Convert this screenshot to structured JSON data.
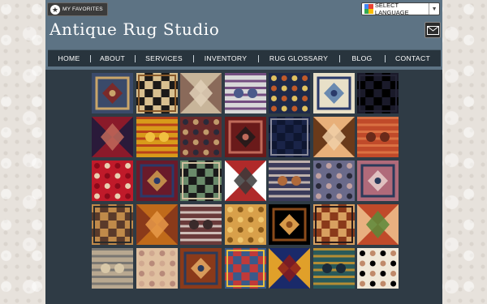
{
  "header": {
    "favorites_label": "MY FAVORITES",
    "language_label": "SELECT LANGUAGE",
    "site_title": "Antique Rug Studio"
  },
  "nav": {
    "items": [
      "HOME",
      "ABOUT",
      "SERVICES",
      "INVENTORY",
      "RUG GLOSSARY",
      "BLOG",
      "CONTACT"
    ]
  },
  "icons": {
    "favorites": "star-icon",
    "language": "google-translate-icon",
    "language_dropdown": "chevron-down-icon",
    "contact": "envelope-icon"
  },
  "colors": {
    "header_bg": "#5d7384",
    "nav_bg": "#28343d",
    "content_bg": "#2f3b45"
  },
  "rugs": [
    [
      "#3a4a6a",
      "#c9a56a",
      "#7a2a2a"
    ],
    [
      "#1c1a18",
      "#d8c090",
      "#8a5a2a"
    ],
    [
      "#c8b59a",
      "#8a6a5a",
      "#e0d0b8"
    ],
    [
      "#d8d8d8",
      "#5a2a6a",
      "#4a5a8a"
    ],
    [
      "#1e2a4a",
      "#c05a2a",
      "#e0c060"
    ],
    [
      "#e8e0c8",
      "#2a3a6a",
      "#6a8ab0"
    ],
    [
      "#000000",
      "#1a1a2a",
      "#242436"
    ],
    [
      "#8a1a2a",
      "#2a1a3a",
      "#c06a5a"
    ],
    [
      "#d89a1a",
      "#b02a1a",
      "#f0c040"
    ],
    [
      "#6a2a2a",
      "#c09a6a",
      "#2a2a3a"
    ],
    [
      "#6a1a1a",
      "#c06a5a",
      "#2a1a1a"
    ],
    [
      "#0e1630",
      "#1a2448",
      "#8a8a9a"
    ],
    [
      "#e8b07a",
      "#6a3a1a",
      "#f0d0a8"
    ],
    [
      "#c04a2a",
      "#e07a4a",
      "#6a2a1a"
    ],
    [
      "#c01a2a",
      "#e8d0b0",
      "#8a0a1a"
    ],
    [
      "#6a1a2a",
      "#2a3a6a",
      "#c08a4a"
    ],
    [
      "#1a1a1a",
      "#6a8a6a",
      "#d0c0a0"
    ],
    [
      "#b02a2a",
      "#ffffff",
      "#3a3a3a"
    ],
    [
      "#3a3a5a",
      "#e0d0c0",
      "#b06a3a"
    ],
    [
      "#6a6a8a",
      "#c0a0a0",
      "#2a2a3a"
    ],
    [
      "#b06a7a",
      "#2a3a5a",
      "#e0c0c0"
    ],
    [
      "#5a3a2a",
      "#c08a4a",
      "#2a2a2a"
    ],
    [
      "#c06a1a",
      "#8a3a1a",
      "#e89a4a"
    ],
    [
      "#6a3a3a",
      "#e8e0d8",
      "#3a2a2a"
    ],
    [
      "#d8a04a",
      "#8a5a1a",
      "#f0c870"
    ],
    [
      "#000000",
      "#8a4a1a",
      "#d89a4a"
    ],
    [
      "#8a3a1a",
      "#d8a060",
      "#2a1a1a"
    ],
    [
      "#c04a2a",
      "#e8b080",
      "#5a8a3a"
    ],
    [
      "#b8a890",
      "#6a6a6a",
      "#d8c8a8"
    ],
    [
      "#e0c0a0",
      "#d0a890",
      "#b88a7a"
    ],
    [
      "#8a3a1a",
      "#2a3a5a",
      "#d89a5a"
    ],
    [
      "#c03a3a",
      "#3a5a8a",
      "#e8c040"
    ],
    [
      "#1a2a6a",
      "#e0a02a",
      "#8a1a1a"
    ],
    [
      "#2a5a5a",
      "#d89a2a",
      "#1a2a3a"
    ],
    [
      "#f0e8d8",
      "#c08a6a",
      "#000000"
    ]
  ]
}
